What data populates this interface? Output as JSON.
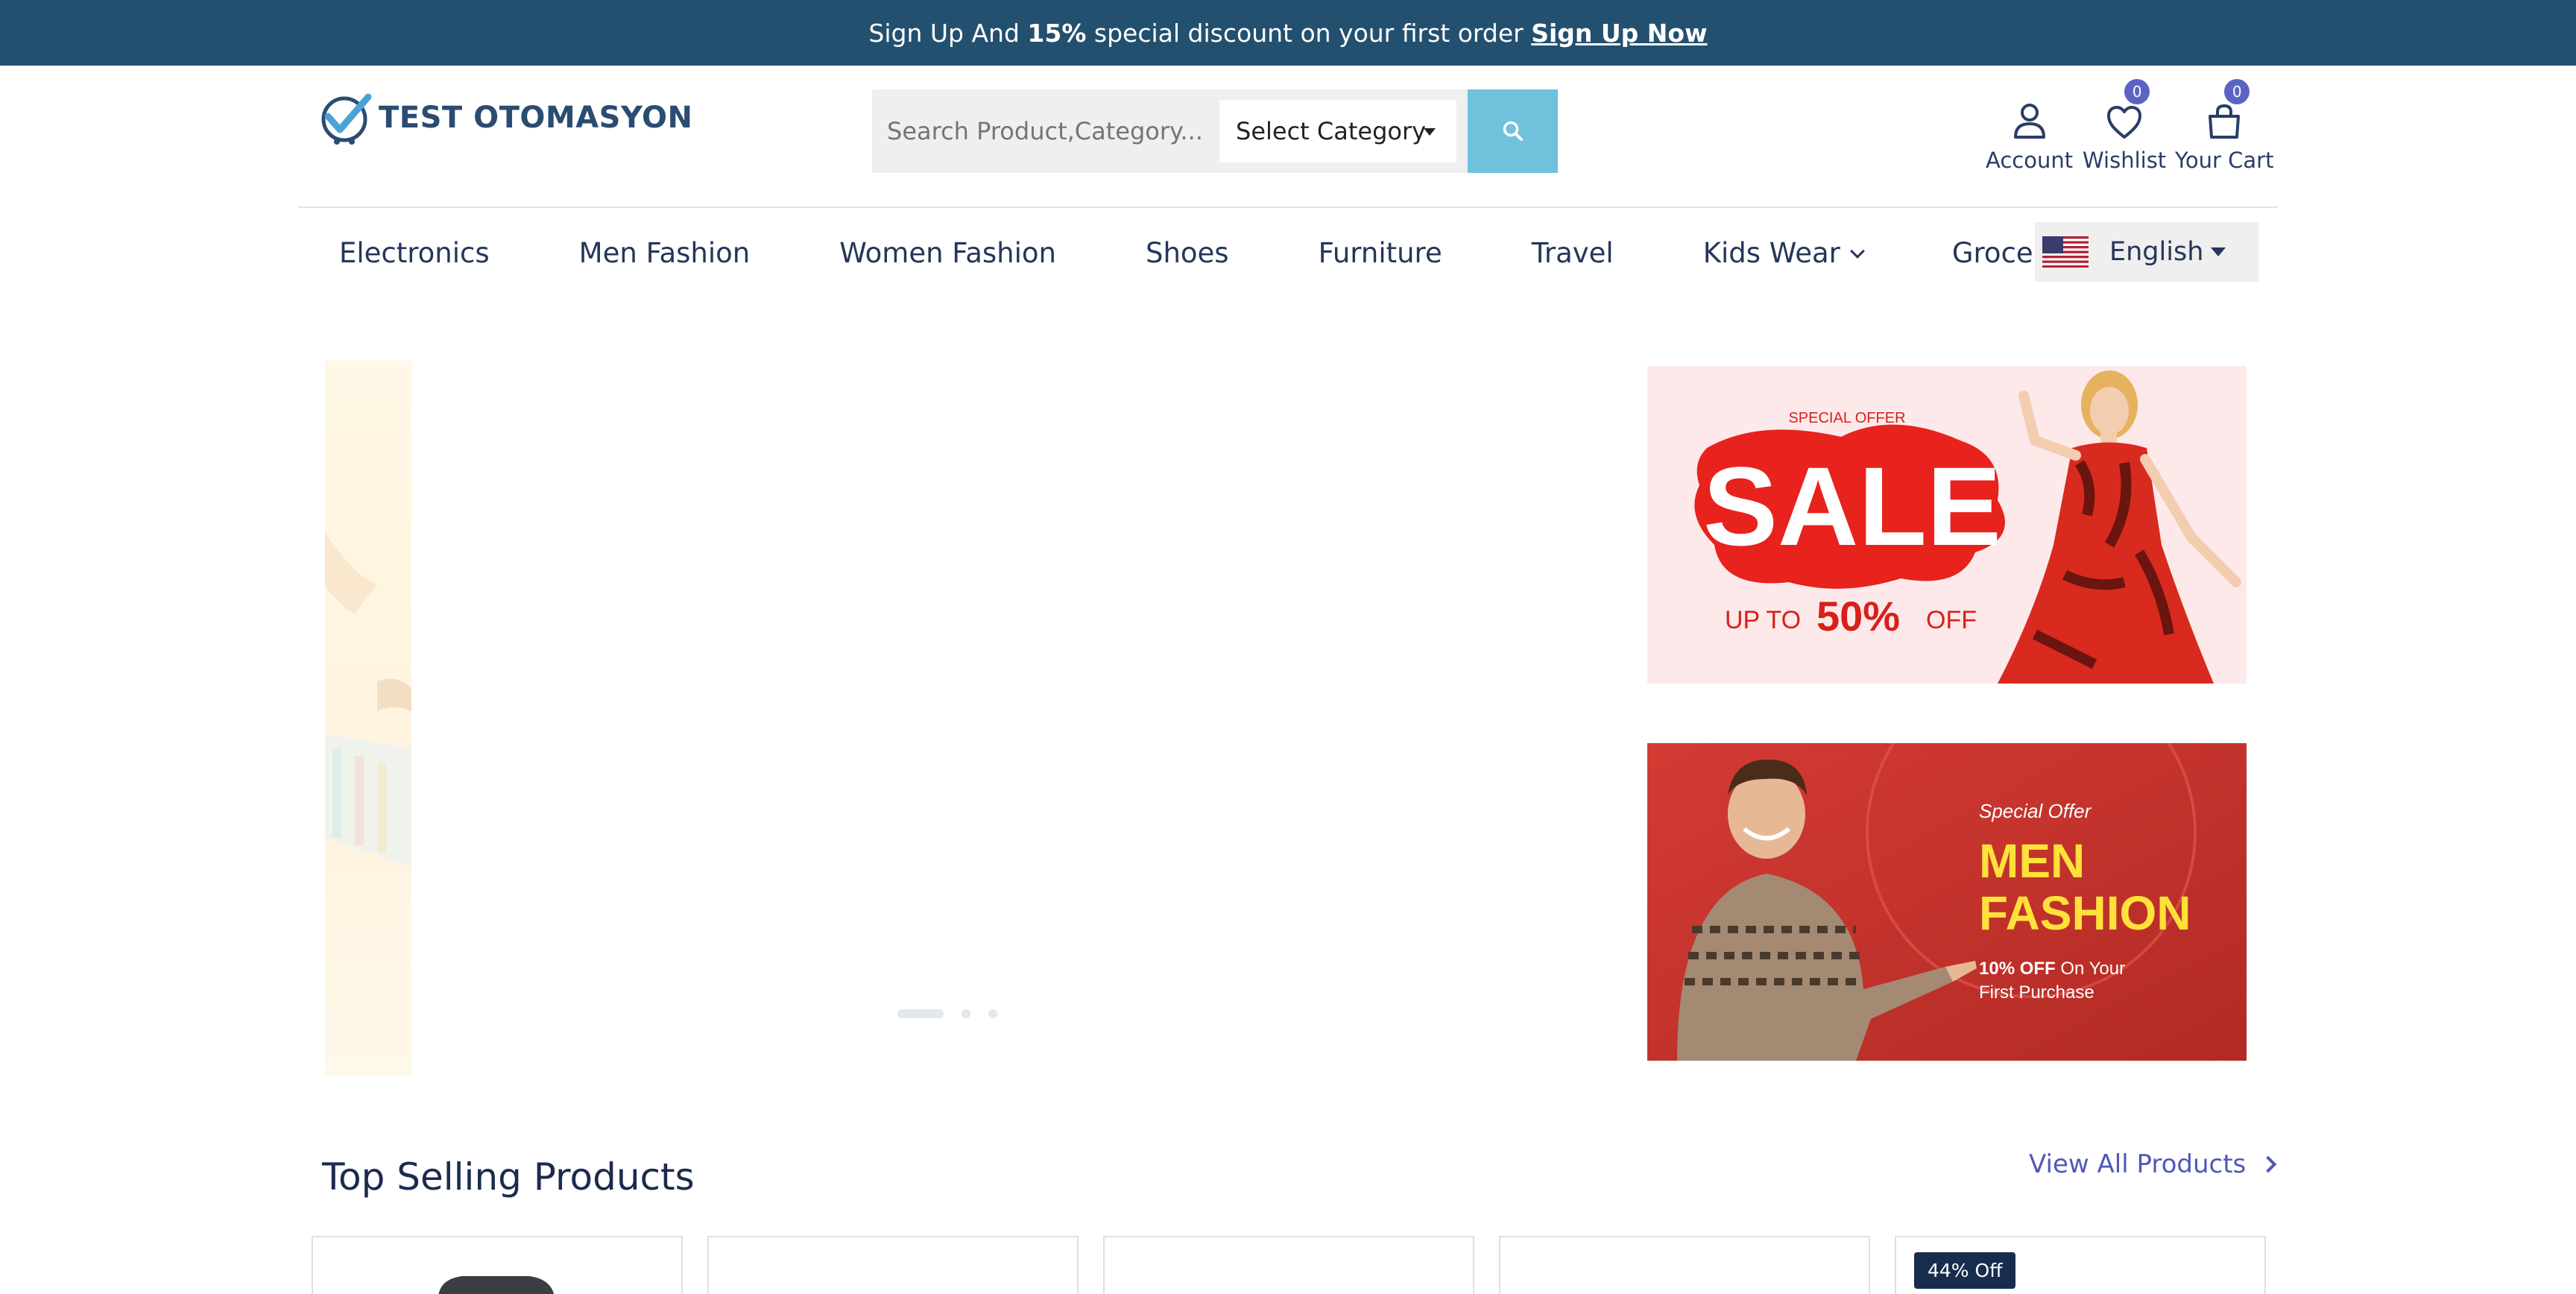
{
  "promo": {
    "part1": "Sign Up And ",
    "bold": "15%",
    "part2": " special discount on your first order ",
    "link": "Sign Up Now"
  },
  "logo": {
    "text": "TEST OTOMASYON"
  },
  "search": {
    "placeholder": "Search Product,Category...",
    "category": "Select Category"
  },
  "header_actions": {
    "account": "Account",
    "wishlist": "Wishlist",
    "wishlist_count": "0",
    "cart": "Your Cart",
    "cart_count": "0"
  },
  "nav": {
    "items": [
      "Electronics",
      "Men Fashion",
      "Women Fashion",
      "Shoes",
      "Furniture",
      "Travel",
      "Kids Wear",
      "Grocery"
    ]
  },
  "language": {
    "selected": "English"
  },
  "banners": {
    "sale": {
      "tag": "SPECIAL OFFER",
      "headline": "SALE",
      "prefix": "UP TO",
      "percent": "50%",
      "suffix": "OFF"
    },
    "men": {
      "tag": "Special Offer",
      "line1": "MEN",
      "line2": "FASHION",
      "offer_bold": "10% OFF",
      "offer_rest": " On Your",
      "offer_line2": "First Purchase"
    }
  },
  "top_selling": {
    "title": "Top Selling Products",
    "view_all": "View All Products",
    "badge": "44% Off"
  },
  "colors": {
    "topbar": "#23506e",
    "accent": "#5b64c4",
    "search_button": "#6fc1dc"
  }
}
